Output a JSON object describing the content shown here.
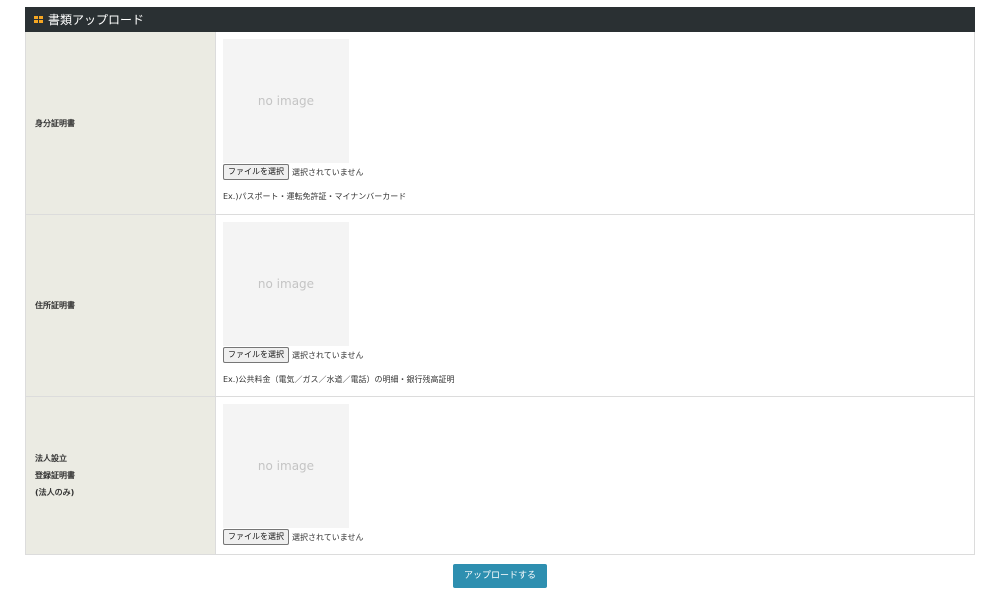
{
  "header": {
    "icon": "grid-icon",
    "accent_color": "#f5a623",
    "title": "書類アップロード"
  },
  "rows": [
    {
      "label_lines": [
        "身分証明書"
      ],
      "placeholder": "no image",
      "file_button": "ファイルを選択",
      "file_status": "選択されていません",
      "example": "Ex.)パスポート・運転免許証・マイナンバーカード"
    },
    {
      "label_lines": [
        "住所証明書"
      ],
      "placeholder": "no image",
      "file_button": "ファイルを選択",
      "file_status": "選択されていません",
      "example": "Ex.)公共料金（電気／ガス／水道／電話）の明細・銀行残高証明"
    },
    {
      "label_lines": [
        "法人設立",
        "登録証明書",
        "(法人のみ)"
      ],
      "placeholder": "no image",
      "file_button": "ファイルを選択",
      "file_status": "選択されていません",
      "example": ""
    }
  ],
  "submit": {
    "label": "アップロードする",
    "color": "#2e8fb0"
  }
}
